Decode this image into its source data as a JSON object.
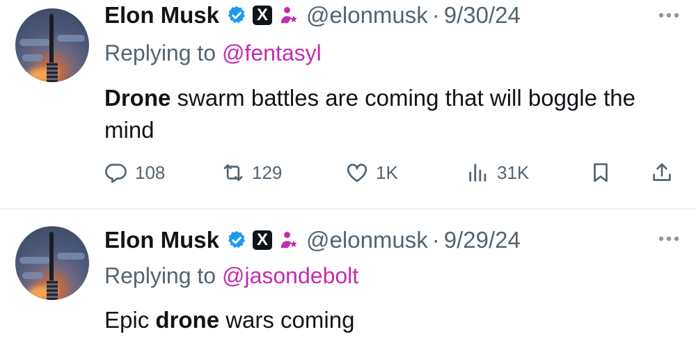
{
  "tweets": [
    {
      "author": {
        "name": "Elon Musk",
        "handle": "@elonmusk"
      },
      "date": "9/30/24",
      "replying_prefix": "Replying to ",
      "replying_to": "@fentasyl",
      "text": {
        "bold": "Drone",
        "rest": " swarm battles are coming that will boggle the mind"
      },
      "stats": {
        "replies": "108",
        "reposts": "129",
        "likes": "1K",
        "views": "31K"
      }
    },
    {
      "author": {
        "name": "Elon Musk",
        "handle": "@elonmusk"
      },
      "date": "9/29/24",
      "replying_prefix": "Replying to ",
      "replying_to": "@jasondebolt",
      "text": {
        "pre": "Epic ",
        "bold": "drone",
        "post": " wars coming"
      }
    }
  ],
  "separator": "·",
  "badges": {
    "x": "X"
  },
  "icons": [
    "verified-icon",
    "x-badge-icon",
    "affiliate-icon",
    "more-icon",
    "reply-icon",
    "repost-icon",
    "like-icon",
    "views-icon",
    "bookmark-icon",
    "share-icon"
  ],
  "colors": {
    "mention": "#c32cae",
    "verified": "#1d9bf0",
    "affiliate": "#c32cae",
    "muted": "#536471",
    "text": "#0f1419"
  }
}
